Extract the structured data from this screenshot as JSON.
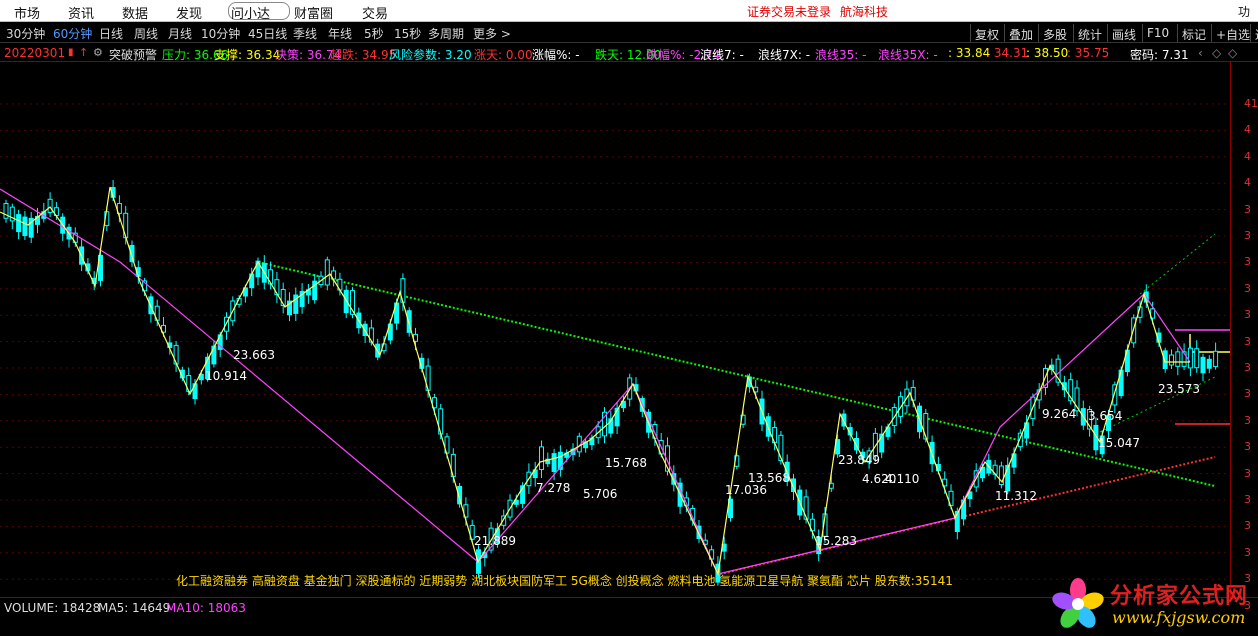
{
  "menu": {
    "items": [
      "市场",
      "资讯",
      "数据",
      "发现",
      "问小达",
      "财富圈",
      "交易"
    ],
    "notice_login": "证券交易未登录",
    "notice_brand": "航海科技",
    "func": "功"
  },
  "toolbar": {
    "periods": [
      "30分钟",
      "60分钟",
      "日线",
      "周线",
      "月线",
      "10分钟",
      "45日线",
      "季线",
      "年线",
      "5秒",
      "15秒",
      "多周期",
      "更多 >"
    ],
    "active": "60分钟",
    "right_buttons": [
      "复权",
      "叠加",
      "多股",
      "统计",
      "画线",
      "F10",
      "标记",
      "+自选",
      "返"
    ]
  },
  "indicator": {
    "date": "20220301",
    "name": "突破预警",
    "fields": [
      {
        "label": "压力:",
        "value": "36.66",
        "color": "#00ff00"
      },
      {
        "label": "支撑:",
        "value": "36.34",
        "color": "#ffff00"
      },
      {
        "label": "决策:",
        "value": "36.74",
        "color": "#ff44ff"
      },
      {
        "label": "超跌:",
        "value": "34.95",
        "color": "#ff3030"
      },
      {
        "label": "风险参数:",
        "value": "3.20",
        "color": "#00ffff"
      },
      {
        "label": "涨天:",
        "value": "0.00",
        "color": "#ff3030"
      },
      {
        "label": "涨幅%:",
        "value": "-",
        "color": "#ffffff"
      },
      {
        "label": "跌天:",
        "value": "12.00",
        "color": "#00ff00"
      },
      {
        "label": "跌幅%:",
        "value": "-2.74",
        "color": "#ff44ff"
      },
      {
        "label": "浪线7:",
        "value": "-",
        "color": "#ffffff"
      },
      {
        "label": "浪线7X:",
        "value": "-",
        "color": "#ffffff"
      },
      {
        "label": "浪线35:",
        "value": "-",
        "color": "#ff44ff"
      },
      {
        "label": "浪线35X:",
        "value": "-",
        "color": "#ff44ff"
      },
      {
        "label": ":",
        "value": "33.84",
        "color": "#ffff00"
      },
      {
        "label": ":",
        "value": "34.31",
        "color": "#ff3030"
      },
      {
        "label": ":",
        "value": "38.50",
        "color": "#ffff00"
      },
      {
        "label": ":",
        "value": "35.75",
        "color": "#ff3030"
      },
      {
        "label": "密码:",
        "value": "7.31",
        "color": "#ffffff"
      }
    ]
  },
  "chart_data": {
    "type": "candlestick",
    "title": "",
    "xlabel": "",
    "ylabel": "",
    "y_axis_ticks": [
      "41",
      "4",
      "4",
      "4",
      "3",
      "3",
      "3",
      "3",
      "3",
      "3",
      "3",
      "3",
      "3",
      "3",
      "3",
      "3",
      "3",
      "3",
      "3",
      "3"
    ],
    "wave_labels": [
      "10.914",
      "23.663",
      "21.889",
      "7.278",
      "5.706",
      "15.768",
      "17.036",
      "13.568",
      "15.283",
      "23.849",
      "4.620",
      "4.110",
      "11.312",
      "9.264",
      "3.654",
      "15.047",
      "23.573"
    ],
    "colors": {
      "up_candle": "#00ffff",
      "down_candle": "#00ffff",
      "zigzag_short": "#ffff60",
      "zigzag_long": "#ff44ff",
      "pressure_line": "#00ff00",
      "support_line": "#ff3030",
      "decision_line": "#ff44ff"
    }
  },
  "concepts": "化工融资融券 高融资盘 基金独门 深股通标的 近期弱势 湖北板块国防军工 5G概念 创投概念 燃料电池 氢能源卫星导航 聚氨酯 芯片 股东数:35141",
  "volume": {
    "label": "VOLUME: 18428",
    "ma5": "MA5: 14649",
    "ma10": "MA10: 18063"
  },
  "watermark": {
    "name": "分析家公式网",
    "url": "www.fxjgsw.com"
  }
}
